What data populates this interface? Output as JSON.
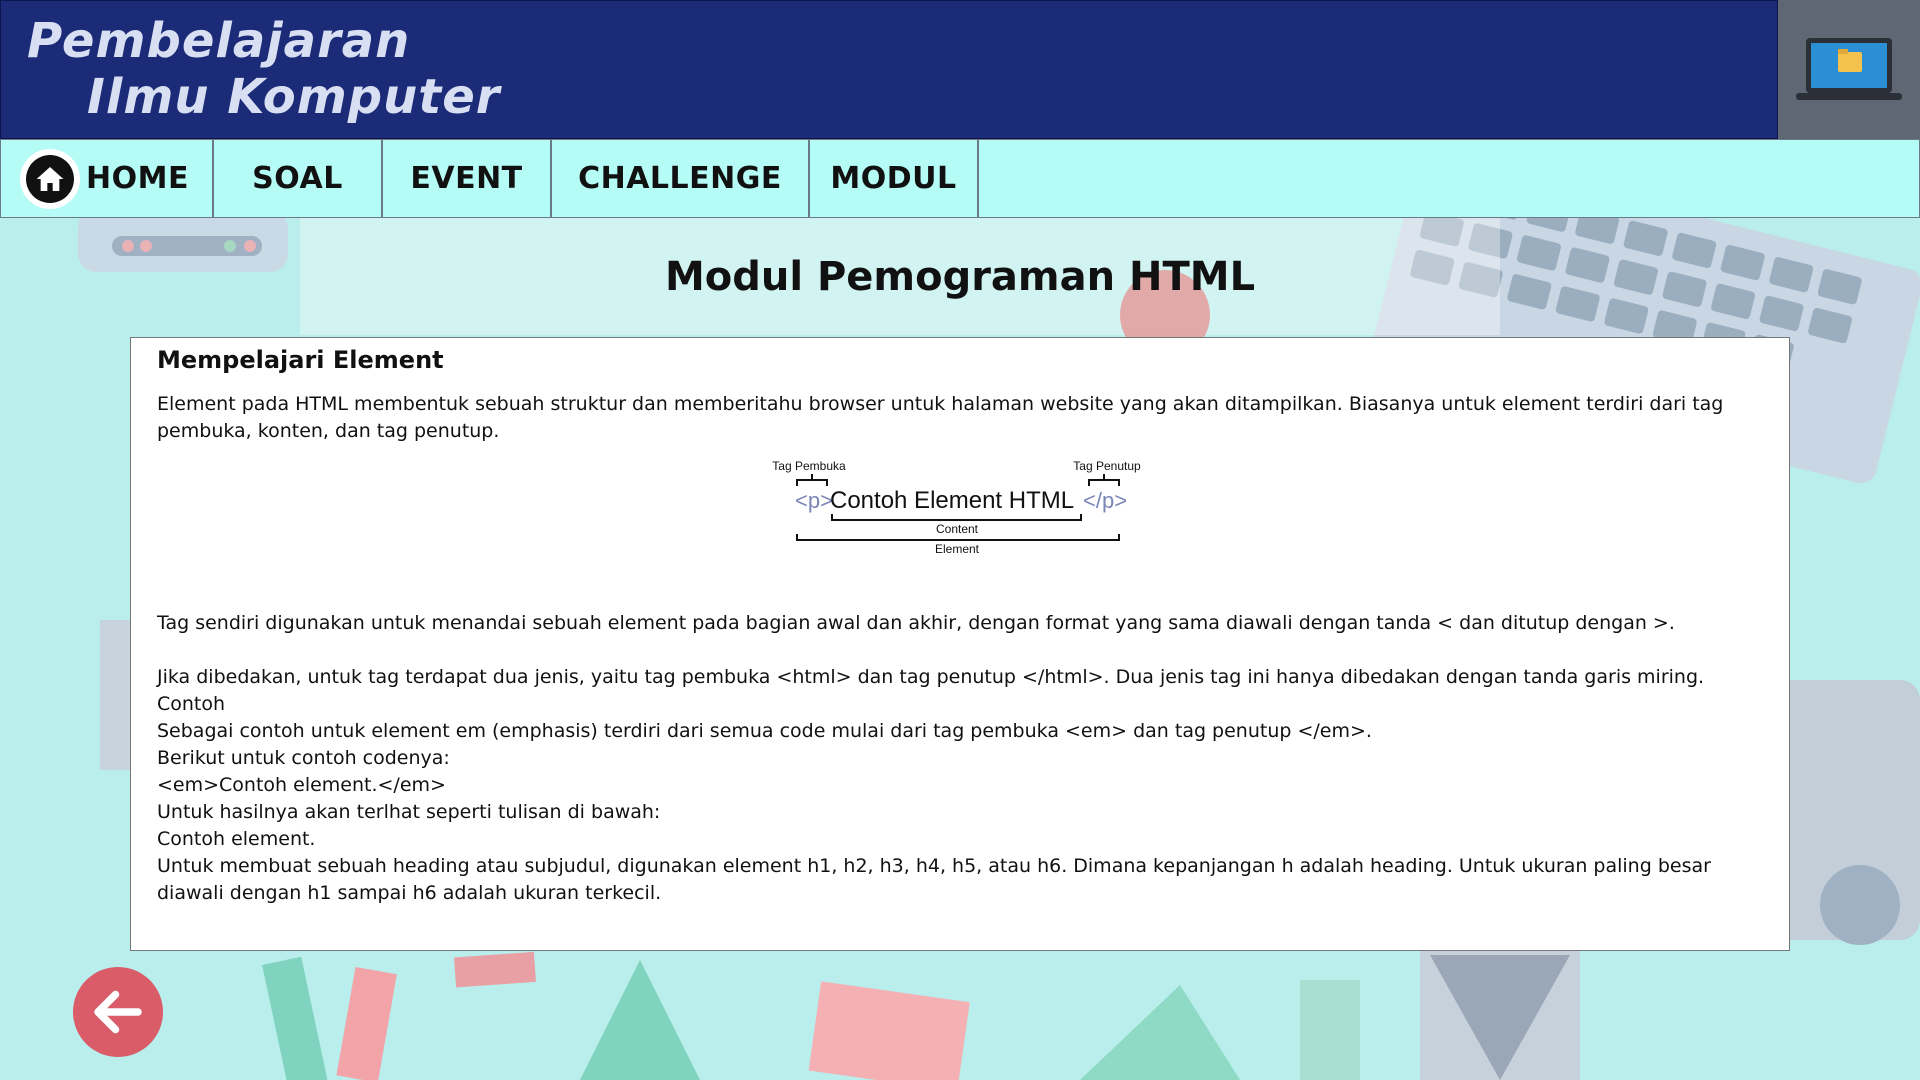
{
  "header": {
    "title_line1": "Pembelajaran",
    "title_line2": "Ilmu Komputer"
  },
  "nav": {
    "items": [
      {
        "label": "HOME"
      },
      {
        "label": "SOAL"
      },
      {
        "label": "EVENT"
      },
      {
        "label": "CHALLENGE"
      },
      {
        "label": "MODUL"
      }
    ]
  },
  "main": {
    "page_title": "Modul Pemograman HTML",
    "card": {
      "title": "Mempelajari Element",
      "intro": "Element pada HTML membentuk sebuah struktur dan memberitahu browser untuk halaman website yang akan ditampilkan. Biasanya untuk element terdiri dari tag pembuka, konten, dan tag penutup.",
      "diagram": {
        "open_label": "Tag Pembuka",
        "close_label": "Tag Penutup",
        "open_tag": "<p>",
        "content": "Contoh Element HTML",
        "close_tag": "</p>",
        "content_label": "Content",
        "element_label": "Element"
      },
      "lines": [
        "Tag sendiri digunakan untuk menandai sebuah element pada bagian awal dan akhir, dengan format yang sama diawali dengan tanda < dan ditutup dengan >.",
        "",
        "Jika dibedakan, untuk tag terdapat dua jenis, yaitu tag pembuka <html> dan tag penutup </html>. Dua jenis tag ini hanya dibedakan dengan tanda garis miring.",
        "Contoh",
        "Sebagai contoh untuk element em (emphasis) terdiri dari semua code mulai dari tag pembuka <em> dan tag penutup </em>.",
        "Berikut untuk contoh codenya:",
        "<em>Contoh element.</em>",
        "Untuk hasilnya akan terlhat seperti tulisan di bawah:",
        "Contoh element.",
        "Untuk membuat sebuah heading atau subjudul, digunakan element h1, h2, h3, h4, h5, atau h6. Dimana kepanjangan h adalah heading. Untuk ukuran paling besar diawali dengan h1 sampai h6 adalah ukuran terkecil."
      ]
    }
  },
  "icons": {
    "home": "home-icon",
    "back": "arrow-left-icon",
    "header_right": "laptop-folder-icon"
  },
  "colors": {
    "header_bg": "#1c2b78",
    "nav_bg": "#b5fbf6",
    "page_bg": "#b7eeeb",
    "back_button": "#d95c68",
    "tag_color": "#7b86b8"
  }
}
